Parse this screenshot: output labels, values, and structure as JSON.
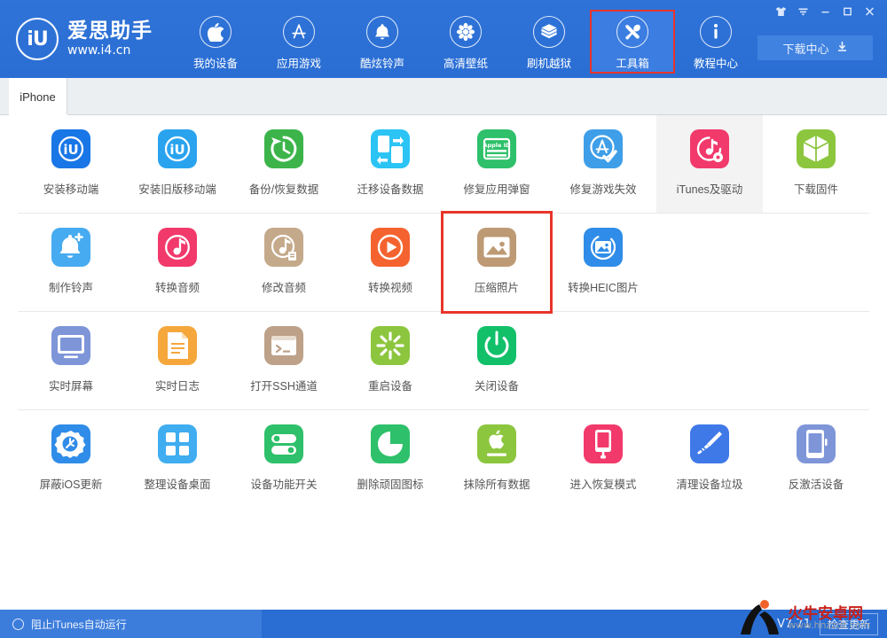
{
  "app": {
    "logo_mark": "iU",
    "logo_title": "爱思助手",
    "logo_url": "www.i4.cn"
  },
  "header": {
    "nav": [
      {
        "label": "我的设备",
        "icon": "apple-icon",
        "state": "normal"
      },
      {
        "label": "应用游戏",
        "icon": "appstore-icon",
        "state": "normal"
      },
      {
        "label": "酷炫铃声",
        "icon": "bell-icon",
        "state": "normal"
      },
      {
        "label": "高清壁纸",
        "icon": "flower-icon",
        "state": "normal"
      },
      {
        "label": "刷机越狱",
        "icon": "openbox-icon",
        "state": "normal"
      },
      {
        "label": "工具箱",
        "icon": "tools-icon",
        "state": "active-highlighted"
      },
      {
        "label": "教程中心",
        "icon": "info-icon",
        "state": "normal"
      }
    ],
    "window_buttons": [
      {
        "name": "skin-icon",
        "glyph": "skin"
      },
      {
        "name": "menu-icon",
        "glyph": "menu"
      },
      {
        "name": "minimize-icon",
        "glyph": "minimize"
      },
      {
        "name": "maximize-icon",
        "glyph": "maximize"
      },
      {
        "name": "close-icon",
        "glyph": "close"
      }
    ],
    "download_center": {
      "label": "下载中心",
      "icon": "download-icon"
    }
  },
  "tabs": [
    {
      "label": "iPhone",
      "active": true
    }
  ],
  "toolbox": {
    "rows": [
      {
        "cells": [
          {
            "label": "安装移动端",
            "icon": "iu-blue-icon",
            "color": "#1976e6",
            "state": "normal"
          },
          {
            "label": "安装旧版移动端",
            "icon": "iu-lightblue-icon",
            "color": "#2aa3ef",
            "state": "normal"
          },
          {
            "label": "备份/恢复数据",
            "icon": "backup-restore-icon",
            "color": "#3cb44a",
            "state": "normal"
          },
          {
            "label": "迁移设备数据",
            "icon": "migrate-icon",
            "color": "#2bc4f4",
            "state": "normal"
          },
          {
            "label": "修复应用弹窗",
            "icon": "appleid-icon",
            "color": "#2ec06a",
            "state": "normal"
          },
          {
            "label": "修复游戏失效",
            "icon": "appstore-check-icon",
            "color": "#3f9ee8",
            "state": "normal"
          },
          {
            "label": "iTunes及驱动",
            "icon": "itunes-gear-icon",
            "color": "#f2396b",
            "state": "selected"
          },
          {
            "label": "下载固件",
            "icon": "cube-icon",
            "color": "#8cc63e",
            "state": "normal"
          }
        ]
      },
      {
        "cells": [
          {
            "label": "制作铃声",
            "icon": "bell-plus-icon",
            "color": "#46abf0",
            "state": "normal"
          },
          {
            "label": "转换音频",
            "icon": "audio-note-icon",
            "color": "#f2396b",
            "state": "normal"
          },
          {
            "label": "修改音频",
            "icon": "audio-edit-icon",
            "color": "#c4a98a",
            "state": "normal"
          },
          {
            "label": "转换视频",
            "icon": "video-play-icon",
            "color": "#f4632f",
            "state": "normal"
          },
          {
            "label": "压缩照片",
            "icon": "photo-icon",
            "color": "#bd9a74",
            "state": "redbox"
          },
          {
            "label": "转换HEIC图片",
            "icon": "heic-photo-icon",
            "color": "#2f8ce8",
            "state": "normal"
          }
        ]
      },
      {
        "cells": [
          {
            "label": "实时屏幕",
            "icon": "monitor-icon",
            "color": "#7e95d8",
            "state": "normal"
          },
          {
            "label": "实时日志",
            "icon": "document-icon",
            "color": "#f5a73c",
            "state": "normal"
          },
          {
            "label": "打开SSH通道",
            "icon": "terminal-icon",
            "color": "#bda188",
            "state": "normal"
          },
          {
            "label": "重启设备",
            "icon": "restart-icon",
            "color": "#8cc63e",
            "state": "normal"
          },
          {
            "label": "关闭设备",
            "icon": "power-icon",
            "color": "#12c06a",
            "state": "normal"
          }
        ]
      },
      {
        "cells": [
          {
            "label": "屏蔽iOS更新",
            "icon": "block-update-icon",
            "color": "#2f8ce8",
            "state": "normal"
          },
          {
            "label": "整理设备桌面",
            "icon": "grid-apps-icon",
            "color": "#3fadf0",
            "state": "normal"
          },
          {
            "label": "设备功能开关",
            "icon": "toggles-icon",
            "color": "#2ec06a",
            "state": "normal"
          },
          {
            "label": "删除顽固图标",
            "icon": "pie-icon",
            "color": "#2ec06a",
            "state": "normal"
          },
          {
            "label": "抹除所有数据",
            "icon": "apple-erase-icon",
            "color": "#8cc63e",
            "state": "normal"
          },
          {
            "label": "进入恢复模式",
            "icon": "recovery-mode-icon",
            "color": "#f2396b",
            "state": "normal"
          },
          {
            "label": "清理设备垃圾",
            "icon": "broom-icon",
            "color": "#3f79e8",
            "state": "normal"
          },
          {
            "label": "反激活设备",
            "icon": "deactivate-icon",
            "color": "#7e95d8",
            "state": "normal"
          }
        ]
      }
    ]
  },
  "statusbar": {
    "block_itunes_label": "阻止iTunes自动运行",
    "version": "V7.71",
    "check_update_label": "检查更新"
  },
  "watermark": {
    "title": "火牛安卓网",
    "url": "www.hnzzdt.com"
  },
  "colors": {
    "header_blue": "#2a6ed4",
    "accent_red": "#e8342a",
    "selected_gray": "#f3f3f3"
  }
}
